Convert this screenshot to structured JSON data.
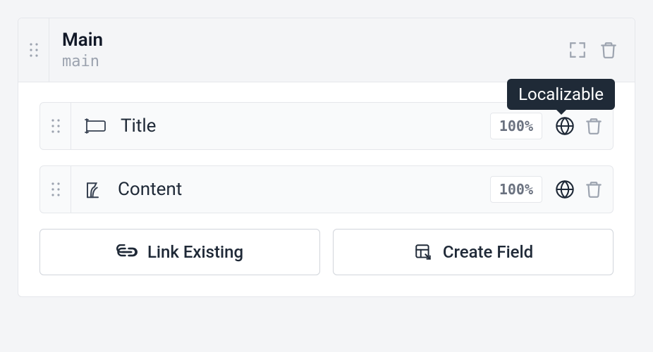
{
  "section": {
    "title": "Main",
    "slug": "main"
  },
  "tooltip": "Localizable",
  "fields": [
    {
      "label": "Title",
      "progress": "100%"
    },
    {
      "label": "Content",
      "progress": "100%"
    }
  ],
  "buttons": {
    "link_existing": "Link Existing",
    "create_field": "Create Field"
  }
}
